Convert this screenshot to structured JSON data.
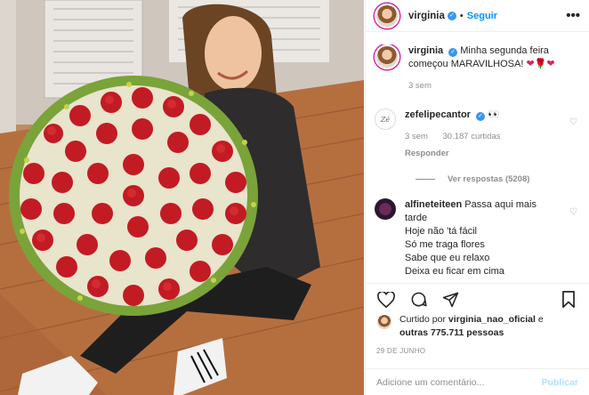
{
  "post": {
    "author": "virginia",
    "follow_label": "Seguir",
    "more_label": "•••",
    "separator": "•"
  },
  "caption": {
    "username": "virginia",
    "text": "Minha segunda feira começou MARAVILHOSA!",
    "time": "3 sem"
  },
  "comments": [
    {
      "username": "zefelipecantor",
      "text": "👀",
      "time": "3 sem",
      "likes": "30.187 curtidas",
      "reply_label": "Responder",
      "view_replies": "Ver respostas (5208)",
      "avatar_text": "Zé"
    },
    {
      "username": "alfineteiteen",
      "lines": [
        "Passa aqui mais",
        "tarde",
        "Hoje não 'tá fácil",
        "Só me traga flores",
        "Sabe que eu relaxo",
        "Deixa eu ficar em cima"
      ]
    }
  ],
  "likes_summary": {
    "prefix": "Curtido por",
    "user": "virginia_nao_oficial",
    "joiner": "e",
    "others": "outras 775.711 pessoas"
  },
  "date": "29 DE JUNHO",
  "comment_box": {
    "placeholder": "Adicione um comentário...",
    "publish_label": "Publicar"
  },
  "icons": {
    "verified": "verified-badge-icon",
    "like": "heart-icon",
    "comment": "comment-icon",
    "share": "paper-plane-icon",
    "save": "bookmark-icon"
  },
  "colors": {
    "link": "#0095f6",
    "verified": "#3897f0",
    "muted": "#8e8e8e",
    "publish_disabled": "#b2dffc"
  }
}
